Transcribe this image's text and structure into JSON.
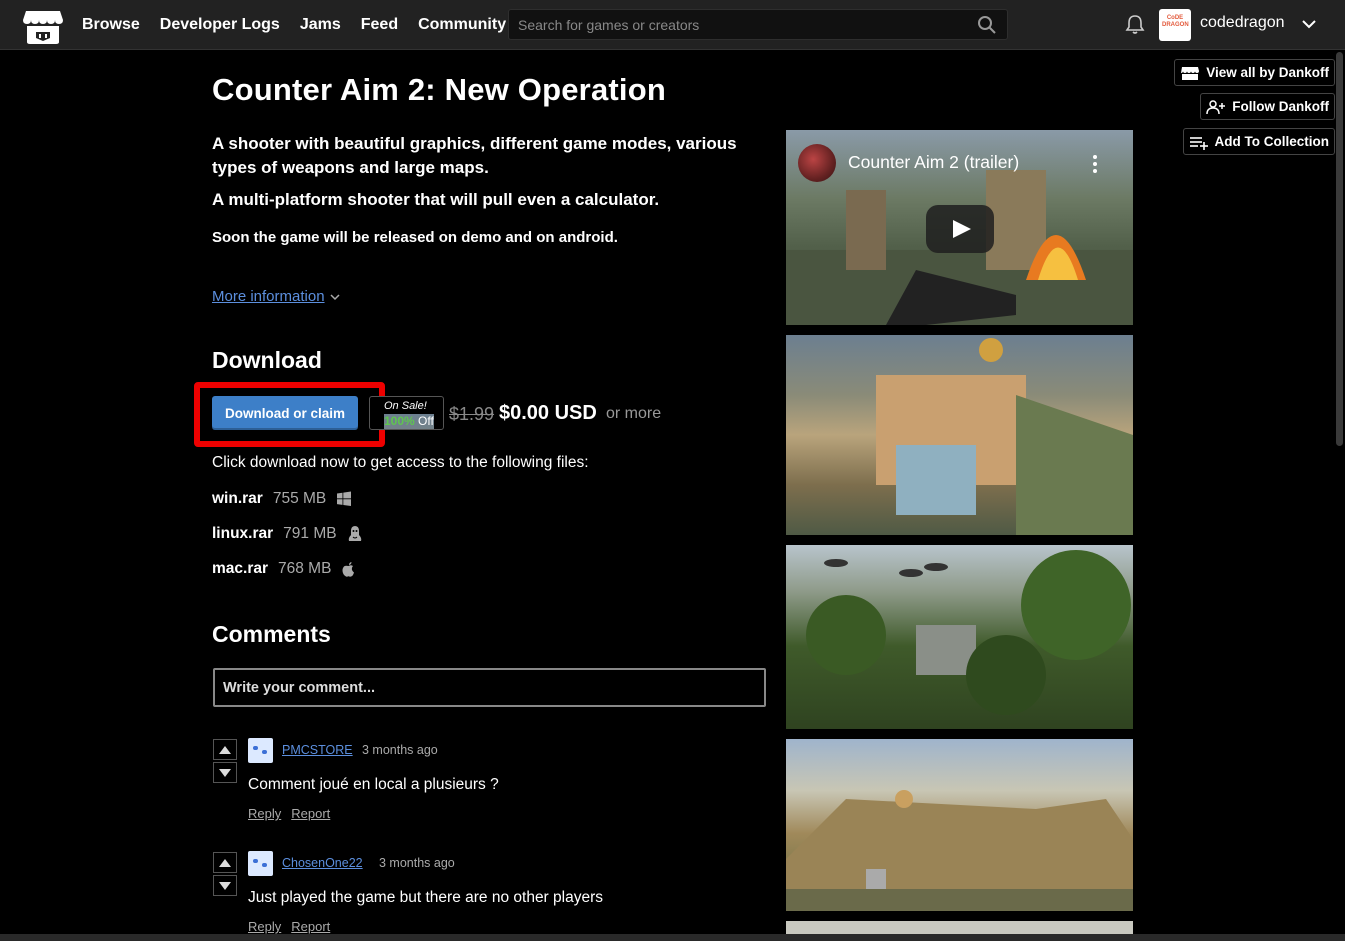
{
  "nav": {
    "items": [
      "Browse",
      "Developer Logs",
      "Jams",
      "Feed",
      "Community"
    ],
    "search_placeholder": "Search for games or creators",
    "username": "codedragon",
    "avatar_text": "CoDE DRAGON"
  },
  "side_buttons": {
    "view_all": "View all by Dankoff",
    "follow": "Follow Dankoff",
    "add_collection": "Add To Collection"
  },
  "game": {
    "title": "Counter Aim 2: New Operation",
    "desc1": "A shooter with beautiful graphics, different game modes, various types of weapons and large maps.",
    "desc2": "A multi-platform shooter that will pull even a calculator.",
    "desc3": "Soon the game will be released on demo and on android.",
    "more_info": "More information"
  },
  "download": {
    "heading": "Download",
    "button": "Download or claim",
    "sale_label": "On Sale!",
    "sale_pct": "100%",
    "sale_off": "Off",
    "old_price": "$1.99",
    "new_price": "$0.00 USD",
    "or_more": "or more",
    "note": "Click download now to get access to the following files:",
    "files": [
      {
        "name": "win.rar",
        "size": "755 MB",
        "icon": "windows-icon"
      },
      {
        "name": "linux.rar",
        "size": "791 MB",
        "icon": "linux-icon"
      },
      {
        "name": "mac.rar",
        "size": "768 MB",
        "icon": "apple-icon"
      }
    ]
  },
  "comments": {
    "heading": "Comments",
    "placeholder": "Write your comment...",
    "items": [
      {
        "user": "PMCSTORE",
        "time": "3 months ago",
        "body": "Comment joué en local a plusieurs ?",
        "reply": "Reply",
        "report": "Report"
      },
      {
        "user": "ChosenOne22",
        "time": "3 months ago",
        "body": "Just played the game but there are no other players",
        "reply": "Reply",
        "report": "Report"
      }
    ]
  },
  "media": {
    "video_title": "Counter Aim 2 (trailer)"
  },
  "colors": {
    "accent_blue": "#3d7fc8",
    "link_blue": "#5c8fde",
    "sale_green": "#5fc64f",
    "highlight_red": "#ee0000"
  }
}
